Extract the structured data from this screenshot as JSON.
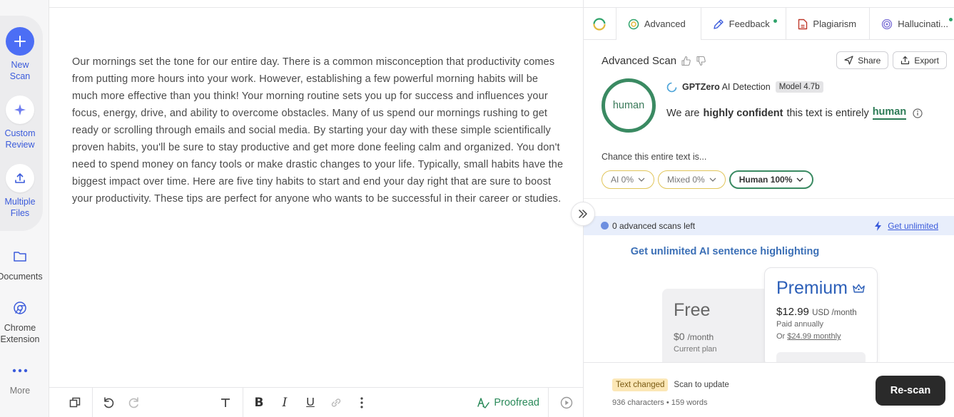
{
  "sidebar": {
    "new_scan": "New\nScan",
    "custom_review": "Custom\nReview",
    "multiple_files": "Multiple\nFiles",
    "documents": "Documents",
    "chrome_extension": "Chrome\nExtension",
    "more": "More"
  },
  "editor": {
    "text": "Our mornings set the tone for our entire day. There is a common misconception that productivity comes from putting more hours into your work. However, establishing a few powerful morning habits will be much more effective than you think! Your morning routine sets you up for success and influences your focus, energy, drive, and ability to overcome obstacles. Many of us spend our mornings rushing to get ready or scrolling through emails and social media. By starting your day with these simple scientifically proven habits, you'll be sure to stay productive and get more done feeling calm and organized. You don't need to spend money on fancy tools or make drastic changes to your life. Typically, small habits have the biggest impact over time. Here are five tiny habits to start and end your day right that are sure to boost your productivity. These tips are perfect for anyone who wants to be successful in their career or studies.",
    "proofread_label": "Proofread"
  },
  "tabs": [
    {
      "label": "Advanced"
    },
    {
      "label": "Feedback"
    },
    {
      "label": "Plagiarism"
    },
    {
      "label": "Hallucinati..."
    }
  ],
  "scan": {
    "title": "Advanced Scan",
    "share_label": "Share",
    "export_label": "Export",
    "result_label": "human",
    "detector": "GPTZero",
    "detector_suffix": "AI Detection",
    "model": "Model 4.7b",
    "confidence_prefix": "We are",
    "confidence_bold": "highly confident",
    "confidence_mid": "this text is entirely",
    "confidence_result": "human",
    "chance_label": "Chance this entire text is...",
    "chips": {
      "ai": "AI 0%",
      "mixed": "Mixed 0%",
      "human": "Human 100%"
    }
  },
  "scans_left": {
    "text": "0 advanced scans left",
    "link": "Get unlimited"
  },
  "upgrade": {
    "title": "Get unlimited AI sentence highlighting",
    "free": {
      "name": "Free",
      "price": "$0",
      "period": "/month",
      "note": "Current plan"
    },
    "premium": {
      "name": "Premium",
      "price": "$12.99",
      "currency": "USD /month",
      "billing": "Paid annually",
      "alt_prefix": "Or",
      "alt_link": "$24.99 monthly"
    }
  },
  "status": {
    "tag": "Text changed",
    "hint": "Scan to update",
    "counts": "936 characters • 159 words",
    "rescan_label": "Re-scan"
  },
  "colors": {
    "accent_blue": "#4c6ef5",
    "human_green": "#3a8a62",
    "ai_yellow": "#e1c55a"
  }
}
